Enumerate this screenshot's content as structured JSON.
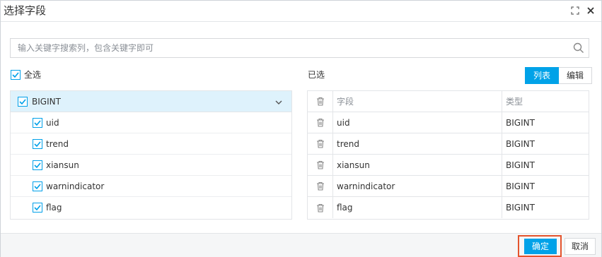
{
  "dialog": {
    "title": "选择字段"
  },
  "search": {
    "placeholder": "输入关键字搜索列，包含关键字即可"
  },
  "select_all": {
    "label": "全选",
    "checked": true
  },
  "left_panel": {
    "group": {
      "label": "BIGINT",
      "checked": true
    },
    "fields": [
      {
        "name": "uid",
        "checked": true
      },
      {
        "name": "trend",
        "checked": true
      },
      {
        "name": "xiansun",
        "checked": true
      },
      {
        "name": "warnindicator",
        "checked": true
      },
      {
        "name": "flag",
        "checked": true
      }
    ]
  },
  "right_panel": {
    "label": "已选",
    "view_toggle": {
      "list_label": "列表",
      "edit_label": "编辑",
      "active": "列表"
    },
    "columns": [
      "字段",
      "类型"
    ],
    "rows": [
      {
        "field": "uid",
        "type": "BIGINT"
      },
      {
        "field": "trend",
        "type": "BIGINT"
      },
      {
        "field": "xiansun",
        "type": "BIGINT"
      },
      {
        "field": "warnindicator",
        "type": "BIGINT"
      },
      {
        "field": "flag",
        "type": "BIGINT"
      }
    ]
  },
  "footer": {
    "confirm_label": "确定",
    "cancel_label": "取消"
  },
  "colors": {
    "accent": "#00a2e8",
    "highlight_border": "#e4542d",
    "group_bg": "#def2fc"
  },
  "icons": [
    "expand-icon",
    "close-icon",
    "search-icon",
    "check-icon",
    "chevron-down-icon",
    "trash-icon"
  ]
}
